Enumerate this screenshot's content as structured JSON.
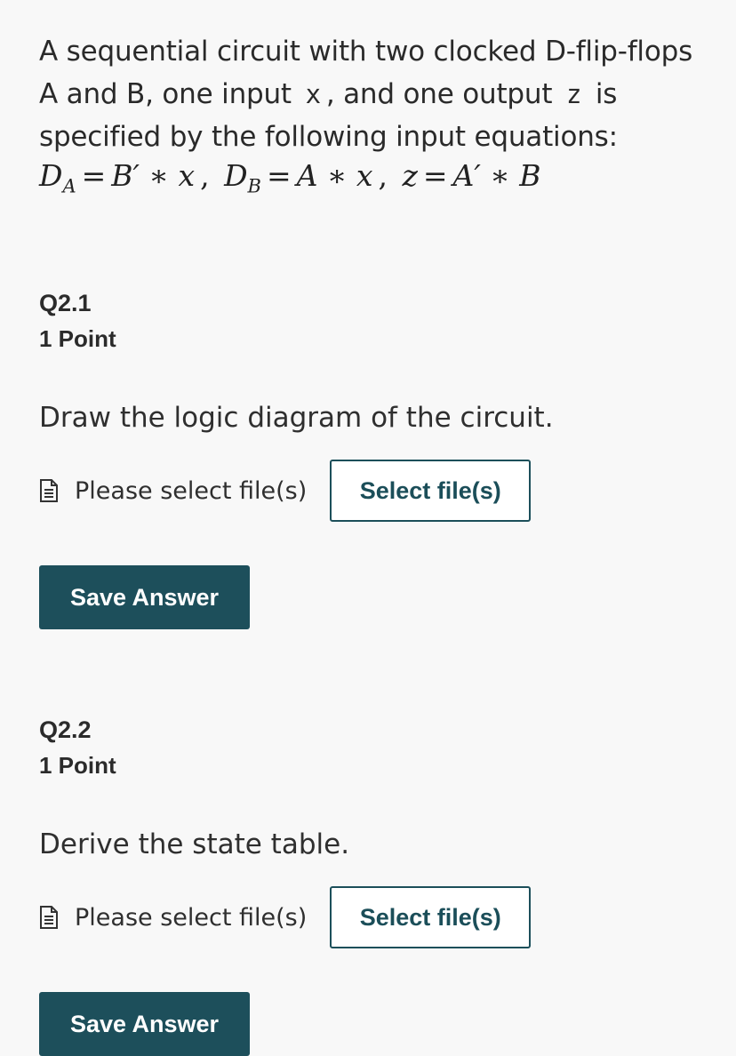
{
  "intro": {
    "text_part1": "A sequential circuit with two clocked D-flip-flops A and B, one input",
    "input_var": "x",
    "text_part2": ", and one output",
    "output_var": "z",
    "text_part3": "is specified by the following input equations:"
  },
  "equations": {
    "da_lhs": "D",
    "da_sub": "A",
    "da_rhs": "B′ ∗ x",
    "db_lhs": "D",
    "db_sub": "B",
    "db_rhs": "A ∗ x",
    "z_lhs": "z",
    "z_rhs": "A′ ∗ B"
  },
  "questions": [
    {
      "number": "Q2.1",
      "points": "1 Point",
      "prompt": "Draw the logic diagram of the circuit.",
      "file_status": "Please select file(s)",
      "select_label": "Select file(s)",
      "save_label": "Save Answer"
    },
    {
      "number": "Q2.2",
      "points": "1 Point",
      "prompt": "Derive the state table.",
      "file_status": "Please select file(s)",
      "select_label": "Select file(s)",
      "save_label": "Save Answer"
    }
  ]
}
